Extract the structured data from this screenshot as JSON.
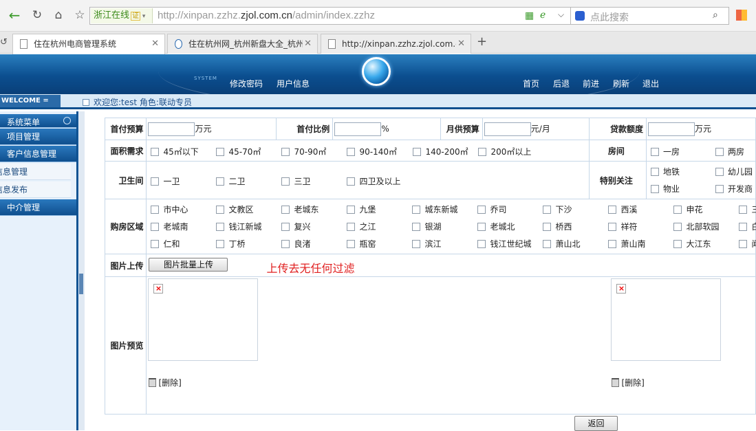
{
  "browser": {
    "badge_text": "浙江在线",
    "badge_cert": "证",
    "url_prefix": "http://xinpan.zzhz.",
    "url_domain": "zjol.com.cn",
    "url_suffix": "/admin/index.zzhz",
    "search_placeholder": "点此搜索",
    "tabs": [
      {
        "label": "住在杭州电商管理系统"
      },
      {
        "label": "住在杭州网_杭州新盘大全_杭州"
      },
      {
        "label": "http://xinpan.zzhz.zjol.com.cn"
      }
    ],
    "new_tab": "+"
  },
  "header": {
    "system_tag": "SYSTEM",
    "left_links": [
      "修改密码",
      "用户信息"
    ],
    "right_links": [
      "首页",
      "后退",
      "前进",
      "刷新",
      "退出"
    ]
  },
  "welcome": {
    "tag": "WELCOME  =",
    "greeting": "欢迎您:test 角色:联动专员"
  },
  "sidebar": {
    "title": "系统菜单",
    "items": [
      {
        "label": "项目管理"
      },
      {
        "label": "客户信息管理"
      },
      {
        "label": "信息管理"
      },
      {
        "label": "信息发布"
      },
      {
        "label": "中介管理"
      }
    ]
  },
  "form": {
    "row1": {
      "down_payment_label": "首付预算",
      "down_payment_unit": "万元",
      "ratio_label": "首付比例",
      "ratio_unit": "%",
      "monthly_label": "月供预算",
      "monthly_unit": "元/月",
      "loan_label": "贷款额度",
      "loan_unit": "万元"
    },
    "area": {
      "label": "面积需求",
      "options": [
        "45㎡以下",
        "45-70㎡",
        "70-90㎡",
        "90-140㎡",
        "140-200㎡",
        "200㎡以上"
      ]
    },
    "rooms": {
      "label": "房间",
      "options": [
        "一房",
        "两房"
      ]
    },
    "bath": {
      "label": "卫生间",
      "options": [
        "一卫",
        "二卫",
        "三卫",
        "四卫及以上"
      ]
    },
    "special": {
      "label": "特别关注",
      "options": [
        "地铁",
        "幼儿园",
        "物业",
        "开发商"
      ]
    },
    "district": {
      "label": "购房区域",
      "rows": [
        [
          "市中心",
          "文教区",
          "老城东",
          "九堡",
          "城东新城",
          "乔司",
          "下沙",
          "西溪",
          "申花",
          "三"
        ],
        [
          "老城南",
          "钱江新城",
          "复兴",
          "之江",
          "银湖",
          "老城北",
          "桥西",
          "祥符",
          "北部软园",
          "白"
        ],
        [
          "仁和",
          "丁桥",
          "良渚",
          "瓶窑",
          "滨江",
          "钱江世纪城",
          "萧山北",
          "萧山南",
          "大江东",
          "闻"
        ]
      ]
    },
    "upload": {
      "label": "图片上传",
      "button": "图片批量上传",
      "note": "上传去无任何过滤"
    },
    "preview": {
      "label": "图片预览",
      "delete": "[删除]",
      "broken_mark": "×"
    },
    "back_button": "返回"
  }
}
